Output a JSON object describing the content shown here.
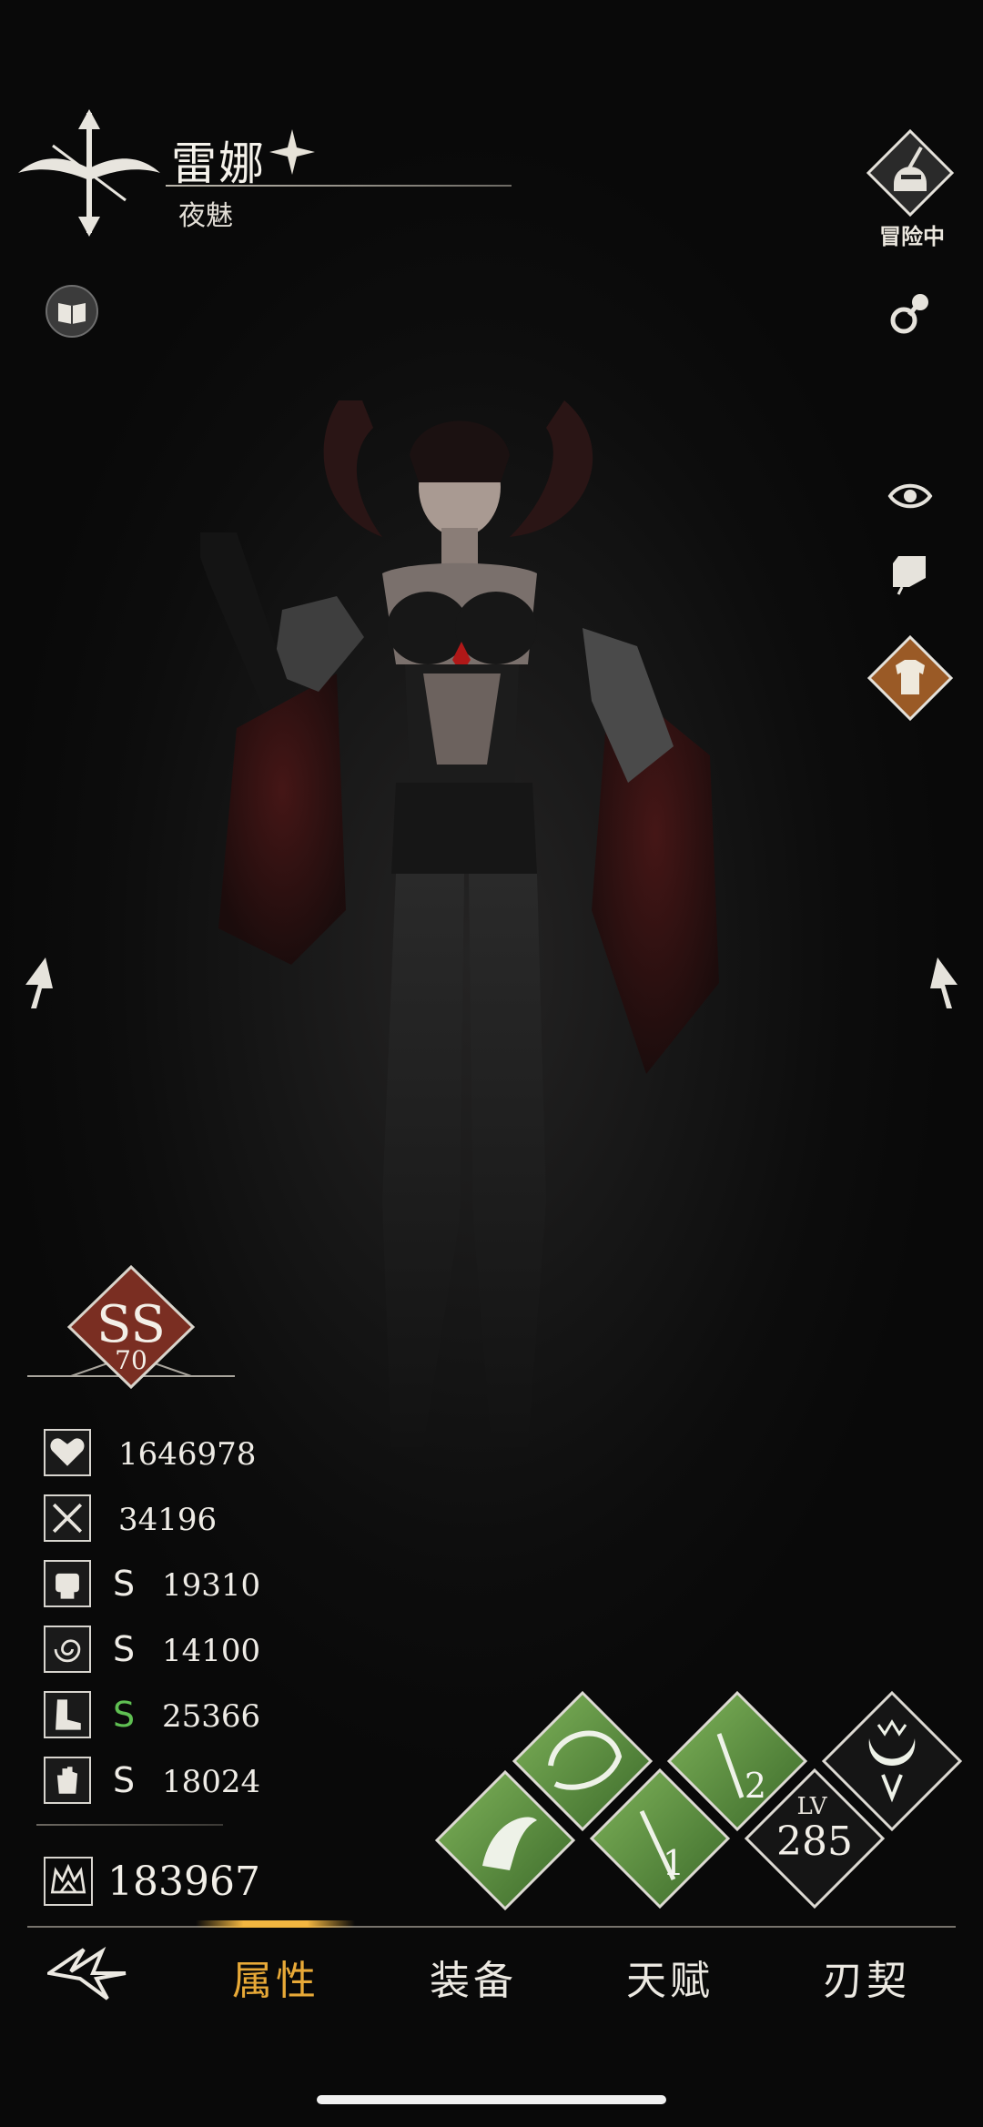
{
  "header": {
    "hero_name": "雷娜",
    "hero_class": "夜魅",
    "status_label": "冒险中"
  },
  "rank": {
    "grade_letter": "SS",
    "grade_level": "70"
  },
  "stats": [
    {
      "icon": "heart-icon",
      "grade": "",
      "value": "1646978"
    },
    {
      "icon": "crossed-swords-icon",
      "grade": "",
      "value": "34196"
    },
    {
      "icon": "fist-icon",
      "grade": "S",
      "value": "19310"
    },
    {
      "icon": "swirl-icon",
      "grade": "S",
      "value": "14100"
    },
    {
      "icon": "boot-icon",
      "grade": "S",
      "value": "25366"
    },
    {
      "icon": "hand-icon",
      "grade": "S",
      "value": "18024"
    }
  ],
  "power": {
    "value": "183967"
  },
  "level": {
    "label": "LV",
    "value": "285"
  },
  "skills": {
    "slot1_number": "1",
    "slot2_number": "2"
  },
  "nav": {
    "tabs": [
      "属性",
      "装备",
      "天赋",
      "刃契"
    ],
    "active_index": 0
  },
  "colors": {
    "accent_gold": "#e8a937",
    "skill_green": "#5a8a3e",
    "rank_red": "#7a2e22",
    "grade_green": "#5fbf52"
  }
}
